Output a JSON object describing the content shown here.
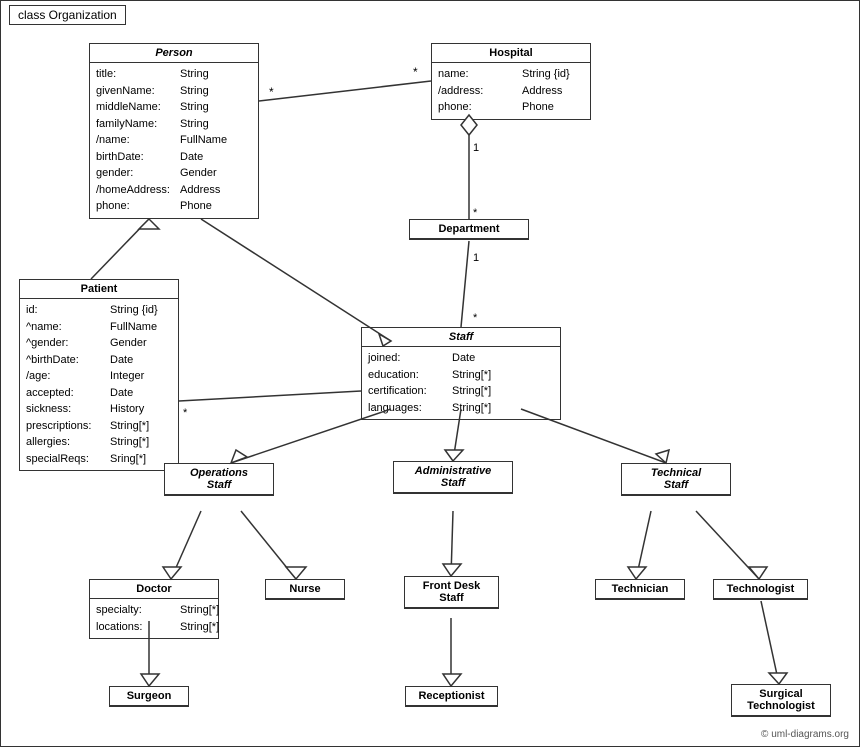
{
  "title": "class Organization",
  "classes": {
    "person": {
      "name": "Person",
      "italic": true,
      "attrs": [
        [
          "title:",
          "String"
        ],
        [
          "givenName:",
          "String"
        ],
        [
          "middleName:",
          "String"
        ],
        [
          "familyName:",
          "String"
        ],
        [
          "/name:",
          "FullName"
        ],
        [
          "birthDate:",
          "Date"
        ],
        [
          "gender:",
          "Gender"
        ],
        [
          "/homeAddress:",
          "Address"
        ],
        [
          "phone:",
          "Phone"
        ]
      ]
    },
    "hospital": {
      "name": "Hospital",
      "italic": false,
      "attrs": [
        [
          "name:",
          "String {id}"
        ],
        [
          "/address:",
          "Address"
        ],
        [
          "phone:",
          "Phone"
        ]
      ]
    },
    "patient": {
      "name": "Patient",
      "italic": false,
      "attrs": [
        [
          "id:",
          "String {id}"
        ],
        [
          "^name:",
          "FullName"
        ],
        [
          "^gender:",
          "Gender"
        ],
        [
          "^birthDate:",
          "Date"
        ],
        [
          "/age:",
          "Integer"
        ],
        [
          "accepted:",
          "Date"
        ],
        [
          "sickness:",
          "History"
        ],
        [
          "prescriptions:",
          "String[*]"
        ],
        [
          "allergies:",
          "String[*]"
        ],
        [
          "specialReqs:",
          "Sring[*]"
        ]
      ]
    },
    "department": {
      "name": "Department",
      "italic": false,
      "attrs": []
    },
    "staff": {
      "name": "Staff",
      "italic": true,
      "attrs": [
        [
          "joined:",
          "Date"
        ],
        [
          "education:",
          "String[*]"
        ],
        [
          "certification:",
          "String[*]"
        ],
        [
          "languages:",
          "String[*]"
        ]
      ]
    },
    "operations_staff": {
      "name": "Operations\nStaff",
      "italic": true,
      "attrs": []
    },
    "administrative_staff": {
      "name": "Administrative\nStaff",
      "italic": true,
      "attrs": []
    },
    "technical_staff": {
      "name": "Technical\nStaff",
      "italic": true,
      "attrs": []
    },
    "doctor": {
      "name": "Doctor",
      "italic": false,
      "attrs": [
        [
          "specialty:",
          "String[*]"
        ],
        [
          "locations:",
          "String[*]"
        ]
      ]
    },
    "nurse": {
      "name": "Nurse",
      "italic": false,
      "attrs": []
    },
    "front_desk_staff": {
      "name": "Front Desk\nStaff",
      "italic": false,
      "attrs": []
    },
    "technician": {
      "name": "Technician",
      "italic": false,
      "attrs": []
    },
    "technologist": {
      "name": "Technologist",
      "italic": false,
      "attrs": []
    },
    "surgeon": {
      "name": "Surgeon",
      "italic": false,
      "attrs": []
    },
    "receptionist": {
      "name": "Receptionist",
      "italic": false,
      "attrs": []
    },
    "surgical_technologist": {
      "name": "Surgical\nTechnologist",
      "italic": false,
      "attrs": []
    }
  },
  "copyright": "© uml-diagrams.org"
}
